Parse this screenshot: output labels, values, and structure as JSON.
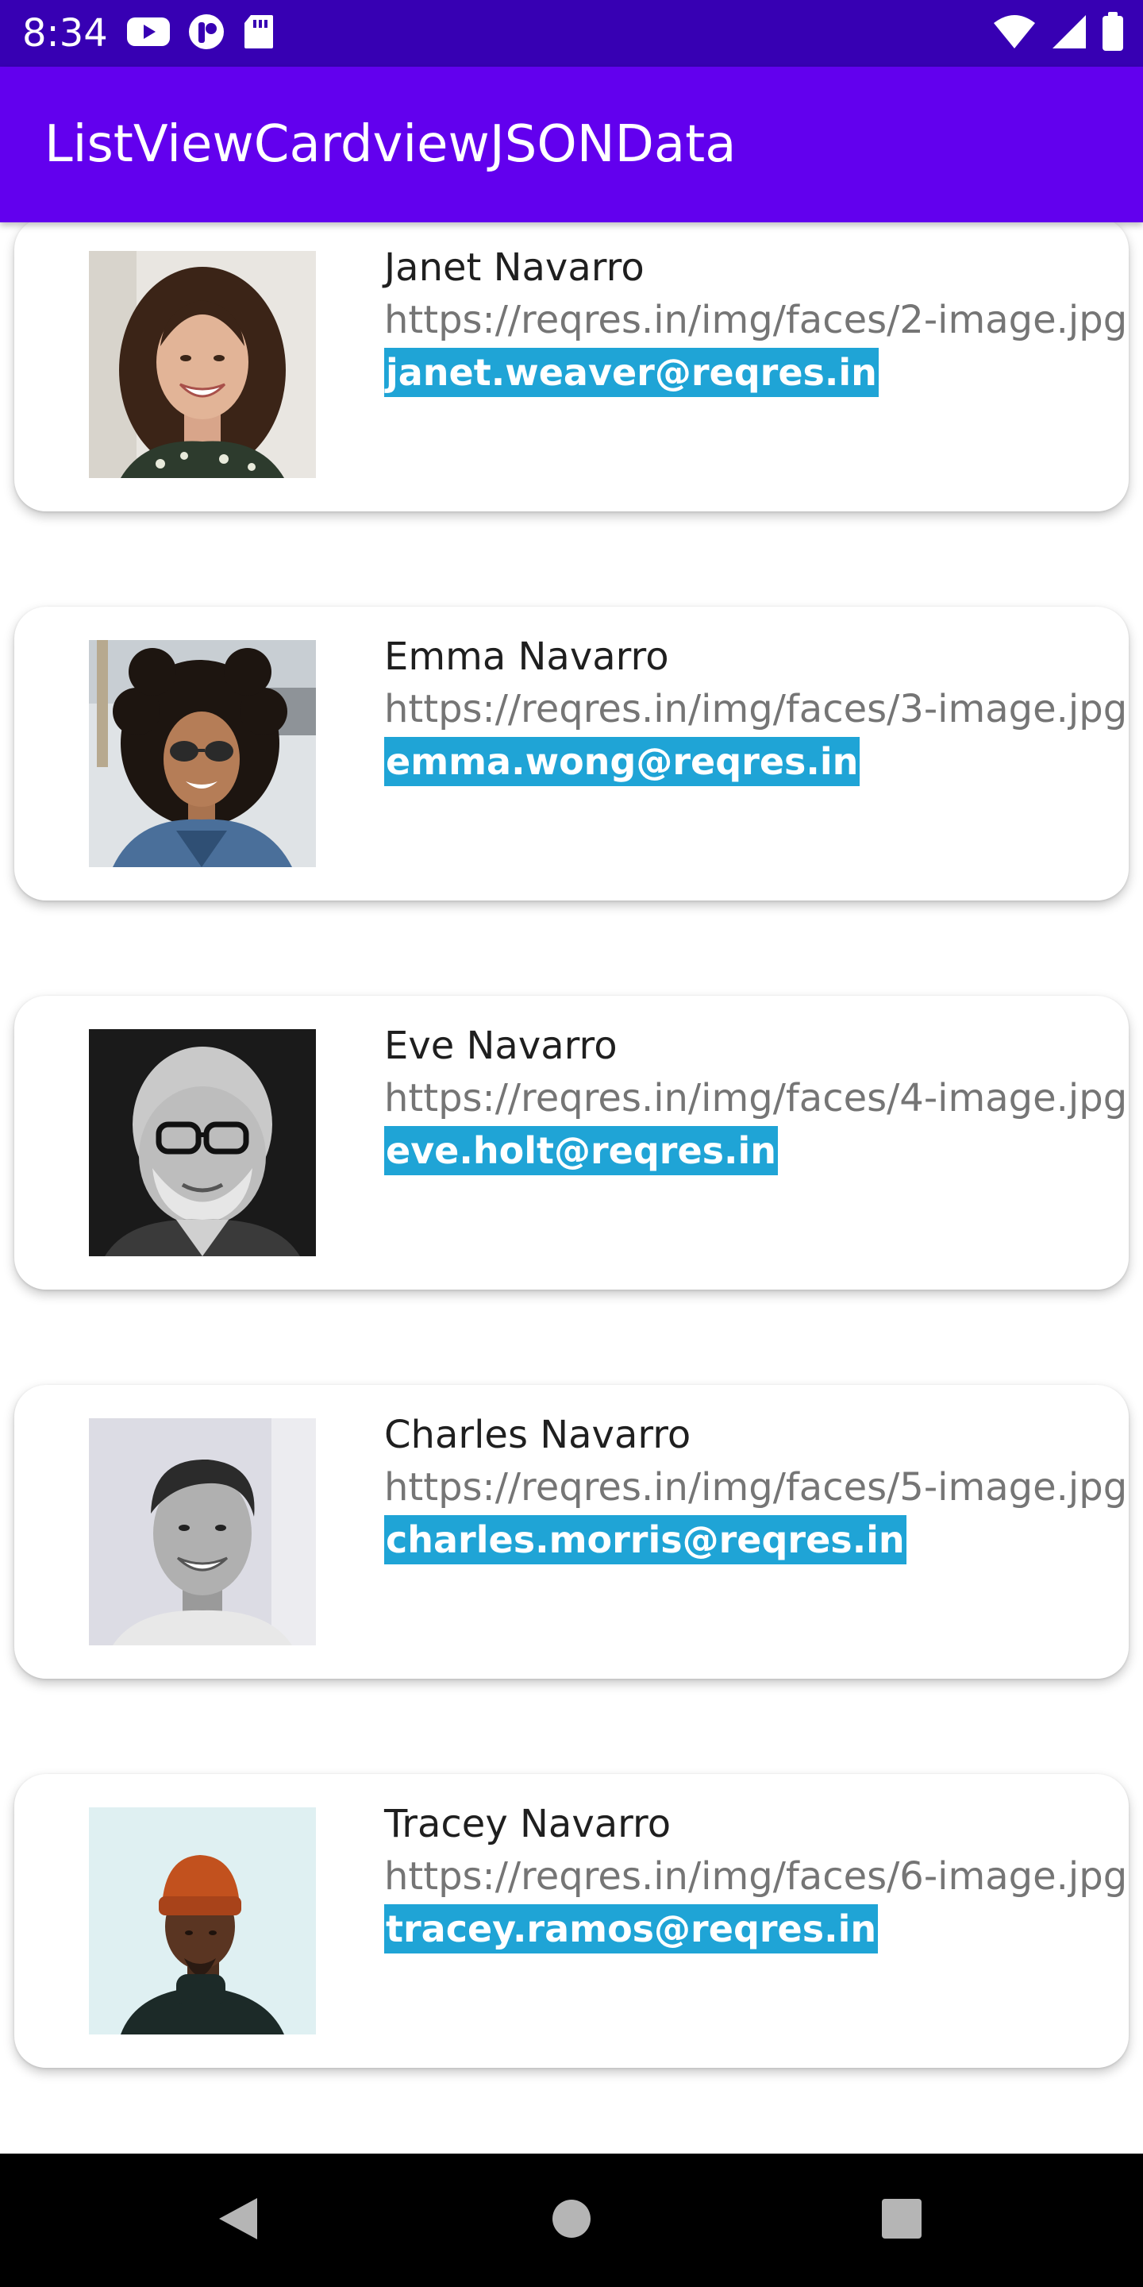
{
  "status_bar": {
    "time": "8:34",
    "left_icons": [
      "youtube-icon",
      "app-notification-icon",
      "sd-card-icon"
    ],
    "right_icons": [
      "wifi-icon",
      "signal-icon",
      "battery-icon"
    ]
  },
  "app_bar": {
    "title": "ListViewCardviewJSONData"
  },
  "cards": [
    {
      "name": "Janet Navarro",
      "url": "https://reqres.in/img/faces/2-image.jpg",
      "email": "janet.weaver@reqres.in"
    },
    {
      "name": "Emma Navarro",
      "url": "https://reqres.in/img/faces/3-image.jpg",
      "email": "emma.wong@reqres.in"
    },
    {
      "name": "Eve Navarro",
      "url": "https://reqres.in/img/faces/4-image.jpg",
      "email": "eve.holt@reqres.in"
    },
    {
      "name": "Charles Navarro",
      "url": "https://reqres.in/img/faces/5-image.jpg",
      "email": "charles.morris@reqres.in"
    },
    {
      "name": "Tracey Navarro",
      "url": "https://reqres.in/img/faces/6-image.jpg",
      "email": "tracey.ramos@reqres.in"
    }
  ],
  "nav_bar": {
    "buttons": [
      "back-icon",
      "home-icon",
      "recents-icon"
    ]
  },
  "colors": {
    "status_bar": "#3700b3",
    "app_bar": "#6200ee",
    "email_highlight": "#1fa4d6"
  }
}
